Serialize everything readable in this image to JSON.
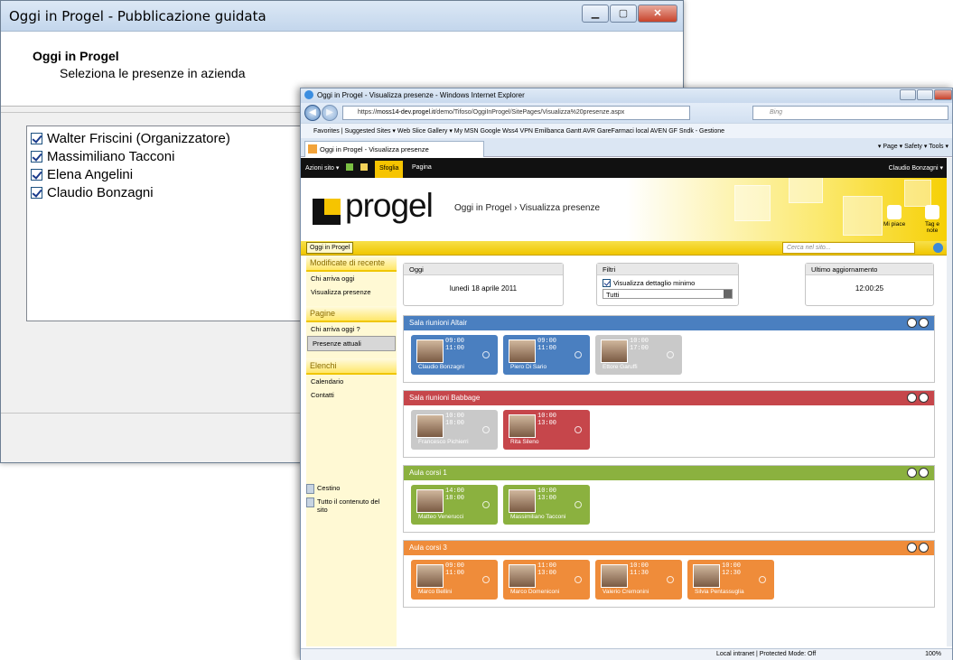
{
  "wizard": {
    "title": "Oggi in Progel - Pubblicazione guidata",
    "heading": "Oggi in Progel",
    "subheading": "Seleziona le presenze in azienda",
    "people": [
      "Walter Friscini (Organizzatore)",
      "Massimiliano Tacconi",
      "Elena Angelini",
      "Claudio Bonzagni"
    ]
  },
  "ie": {
    "title": "Oggi in Progel - Visualizza presenze - Windows Internet Explorer",
    "url_prefix": "https://",
    "url_host": "moss14-dev.progel.it",
    "url_path": "/demo/Tifoso/OggiInProgel/SitePages/Visualizza%20presenze.aspx",
    "search_placeholder": "Bing",
    "favorites": "Favorites   |   Suggested Sites ▾   Web Slice Gallery ▾   My MSN   Google   Wss4   VPN Emilbanca   Gantt   AVR GareFarmaci local   AVEN GF   Sndk - Gestione",
    "tab": "Oggi in Progel - Visualizza presenze",
    "tools": "▾  Page ▾  Safety ▾  Tools ▾",
    "status_zone": "Local intranet | Protected Mode: Off",
    "zoom": "100%"
  },
  "sp": {
    "ribbon_actions": "Azioni sito ▾",
    "ribbon_browse": "Sfoglia",
    "ribbon_page": "Pagina",
    "user": "Claudio Bonzagni ▾",
    "logo": "progel",
    "breadcrumb": "Oggi in Progel › Visualizza presenze",
    "like": "Mi piace",
    "tags": "Tag e note",
    "topnav_item": "Oggi in Progel",
    "search_placeholder": "Cerca nel sito...",
    "quick_launch": {
      "recent_header": "Modificate di recente",
      "recent": [
        "Chi arriva oggi",
        "Visualizza presenze"
      ],
      "pages_header": "Pagine",
      "pages": [
        "Chi arriva oggi ?",
        "Presenze attuali"
      ],
      "lists_header": "Elenchi",
      "lists": [
        "Calendario",
        "Contatti"
      ],
      "recycle": "Cestino",
      "all_content": "Tutto il contenuto del sito"
    },
    "today": {
      "label": "Oggi",
      "value": "lunedì 18 aprile 2011"
    },
    "filters": {
      "label": "Filtri",
      "check": "Visualizza dettaglio minimo",
      "select": "Tutti"
    },
    "last_update": {
      "label": "Ultimo aggiornamento",
      "value": "12:00:25"
    },
    "rooms": [
      {
        "name": "Sala riunioni Altair",
        "color": "#4a7fc0",
        "cards": [
          {
            "time_in": "09:00",
            "time_out": "11:00",
            "name": "Claudio Bonzagni",
            "color": "#4a7fc0"
          },
          {
            "time_in": "09:00",
            "time_out": "11:00",
            "name": "Piero Di Sario",
            "color": "#4a7fc0"
          },
          {
            "time_in": "10:00",
            "time_out": "17:00",
            "name": "Ettore Garuffi",
            "color": "#c9c9c9"
          }
        ]
      },
      {
        "name": "Sala riunioni Babbage",
        "color": "#c6464b",
        "cards": [
          {
            "time_in": "10:00",
            "time_out": "18:00",
            "name": "Francesco Pichierri",
            "color": "#c9c9c9"
          },
          {
            "time_in": "10:00",
            "time_out": "13:00",
            "name": "Rita Sileno",
            "color": "#c6464b"
          }
        ]
      },
      {
        "name": "Aula corsi 1",
        "color": "#8bb13f",
        "cards": [
          {
            "time_in": "14:00",
            "time_out": "18:00",
            "name": "Matteo Venerucci",
            "color": "#8bb13f"
          },
          {
            "time_in": "10:00",
            "time_out": "13:00",
            "name": "Massimiliano Tacconi",
            "color": "#8bb13f"
          }
        ]
      },
      {
        "name": "Aula corsi 3",
        "color": "#ef8c3a",
        "cards": [
          {
            "time_in": "09:00",
            "time_out": "11:00",
            "name": "Marco Bellini",
            "color": "#ef8c3a"
          },
          {
            "time_in": "11:00",
            "time_out": "13:00",
            "name": "Marco Domeniconi",
            "color": "#ef8c3a"
          },
          {
            "time_in": "10:00",
            "time_out": "11:30",
            "name": "Valerio Cremonini",
            "color": "#ef8c3a"
          },
          {
            "time_in": "10:00",
            "time_out": "12:30",
            "name": "Silvia Pentassuglia",
            "color": "#ef8c3a"
          }
        ]
      }
    ]
  }
}
